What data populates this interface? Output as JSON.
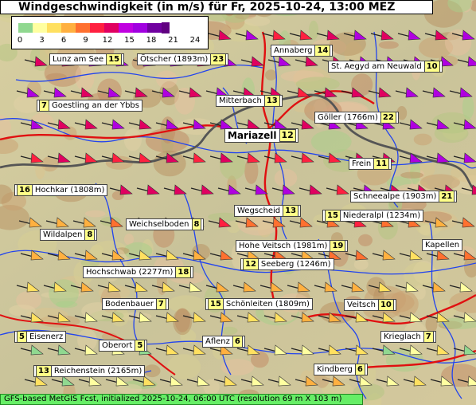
{
  "header": {
    "title": "Windgeschwindigkeit (in m/s) für Fr, 2025-10-24, 13:00 MEZ"
  },
  "legend": {
    "ticks": [
      "0",
      "3",
      "6",
      "9",
      "12",
      "15",
      "18",
      "21",
      "24"
    ],
    "colors": [
      "#90d890",
      "#ffffa0",
      "#ffe060",
      "#ffb040",
      "#ff7030",
      "#ff2040",
      "#e00060",
      "#c000e0",
      "#a000e0",
      "#7000a0",
      "#600080"
    ]
  },
  "places": [
    {
      "name": "Lunz am See",
      "speed": "15"
    },
    {
      "name": "Ötscher (1893m)",
      "speed": "23"
    },
    {
      "name": "Annaberg",
      "speed": "14"
    },
    {
      "name": "St. Aegyd am Neuwald",
      "speed": "10"
    },
    {
      "name": "Goestling an der Ybbs",
      "speed": "7"
    },
    {
      "name": "Mitterbach",
      "speed": "13"
    },
    {
      "name": "Göller (1766m)",
      "speed": "22"
    },
    {
      "name": "Mariazell",
      "speed": "12"
    },
    {
      "name": "Frein",
      "speed": "11"
    },
    {
      "name": "Hochkar (1808m)",
      "speed": "16"
    },
    {
      "name": "Schneealpe (1903m)",
      "speed": "21"
    },
    {
      "name": "Wegscheid",
      "speed": "13"
    },
    {
      "name": "Niederalpl (1234m)",
      "speed": "15"
    },
    {
      "name": "Weichselboden",
      "speed": "8"
    },
    {
      "name": "Wildalpen",
      "speed": "8"
    },
    {
      "name": "Hohe Veitsch (1981m)",
      "speed": "19"
    },
    {
      "name": "Kapellen",
      "speed": ""
    },
    {
      "name": "Seeberg (1246m)",
      "speed": "12"
    },
    {
      "name": "Hochschwab (2277m)",
      "speed": "18"
    },
    {
      "name": "Bodenbauer",
      "speed": "7"
    },
    {
      "name": "Schönleiten (1809m)",
      "speed": "15"
    },
    {
      "name": "Veitsch",
      "speed": "10"
    },
    {
      "name": "Eisenerz",
      "speed": "5"
    },
    {
      "name": "Oberort",
      "speed": "5"
    },
    {
      "name": "Aflenz",
      "speed": "6"
    },
    {
      "name": "Krieglach",
      "speed": "7"
    },
    {
      "name": "Reichenstein (2165m)",
      "speed": "13"
    },
    {
      "name": "Kindberg",
      "speed": "6"
    }
  ],
  "footer": {
    "text": "GFS-based MetGIS Fcst, initialized 2025-10-24, 06:00 UTC  (resolution 69 m X 103 m)"
  }
}
